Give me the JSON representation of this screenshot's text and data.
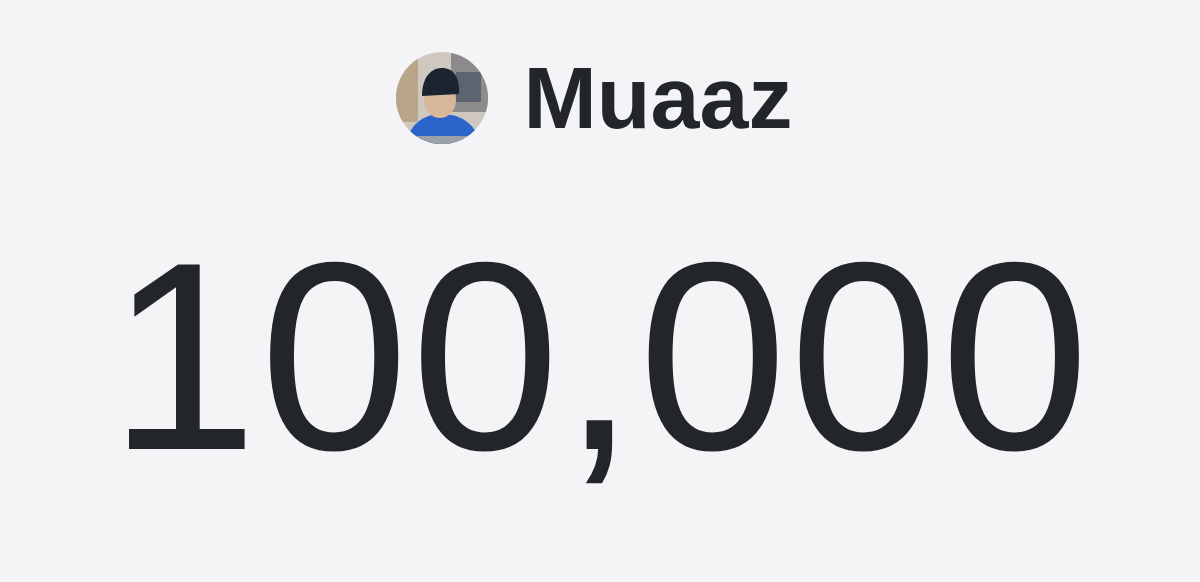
{
  "profile": {
    "name": "Muaaz"
  },
  "count": "100,000"
}
